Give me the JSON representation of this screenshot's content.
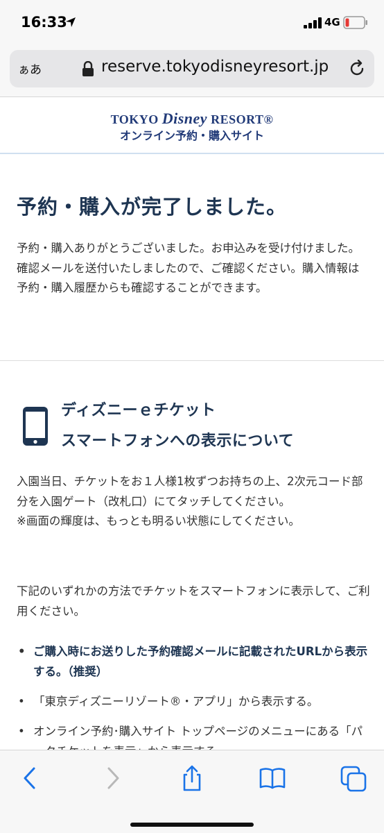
{
  "status_bar": {
    "time": "16:33",
    "network": "4G",
    "battery_color": "#e53935"
  },
  "browser": {
    "aa_label": "ぁあ",
    "url": "reserve.tokyodisneyresort.jp",
    "icons": [
      "lock-icon",
      "reload-icon"
    ]
  },
  "site_header": {
    "logo_tokyo": "TOKYO ",
    "logo_disney": "Disney",
    "logo_resort": " RESORT®",
    "subtitle": "オンライン予約・購入サイト",
    "brand_color": "#213a78"
  },
  "main": {
    "title": "予約・購入が完了しました。",
    "intro": "予約・購入ありがとうございました。お申込みを受け付けました。確認メールを送付いたしましたので、ご確認ください。購入情報は予約・購入履歴からも確認することができます。",
    "section": {
      "icon": "smartphone-icon",
      "title_line1": "ディズニーｅチケット",
      "title_line2": "スマートフォンへの表示について",
      "para1": "入園当日、チケットをお１人様1枚ずつお持ちの上、2次元コード部分を入園ゲート（改札口）にてタッチしてください。",
      "para1_note": "※画面の輝度は、もっとも明るい状態にしてください。",
      "para2": "下記のいずれかの方法でチケットをスマートフォンに表示して、ご利用ください。",
      "bullets": [
        "ご購入時にお送りした予約確認メールに記載されたURLから表示する。（推奨）",
        "「東京ディズニーリゾート®・アプリ」から表示する。",
        "オンライン予約･購入サイト トップページのメニューにある「パークチケットを表示」から表示する。"
      ]
    }
  },
  "toolbar": {
    "icons": [
      "back-icon",
      "forward-icon",
      "share-icon",
      "bookmarks-icon",
      "tabs-icon"
    ],
    "accent_color": "#1a73e8"
  }
}
